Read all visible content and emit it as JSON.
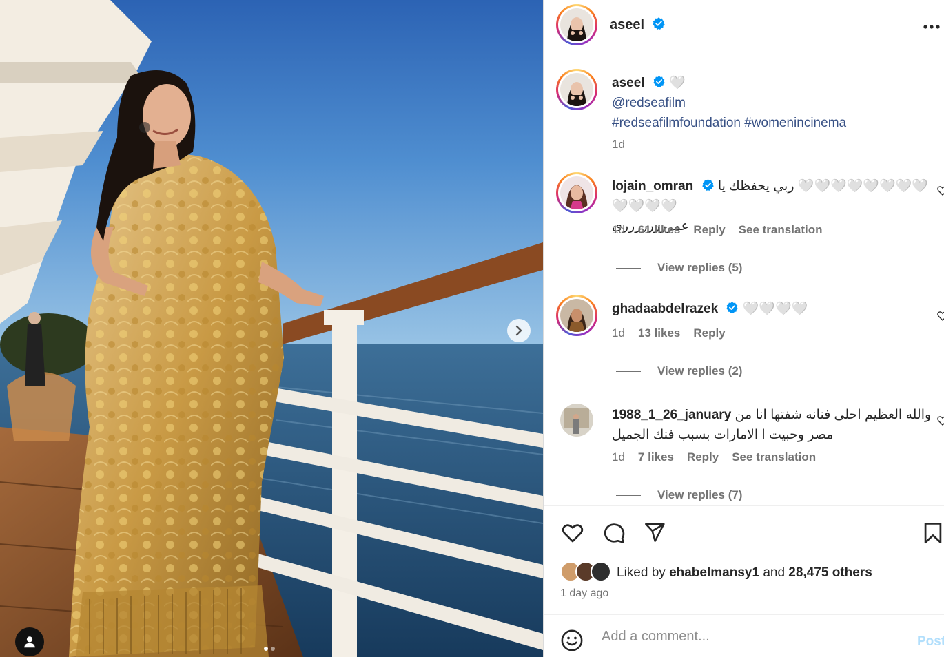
{
  "media": {
    "dots_total": 2,
    "dots_active": 0,
    "next_icon": "chevron-right-icon",
    "tag_icon": "user-tag-icon"
  },
  "post": {
    "author": "aseel",
    "caption_emoji": "🤍",
    "caption_mention": "@redseafilm",
    "caption_hashtags": "#redseafilmfoundation #womenincinema",
    "caption_time": "1d"
  },
  "comments": [
    {
      "user": "lojain_omran",
      "verified": true,
      "text_line1": "ربي يحفظك يا 🤍🤍🤍🤍🤍🤍🤍🤍🤍🤍🤍🤍",
      "text_line2": "عمرررررررري",
      "time": "1d",
      "likes": "61 likes",
      "reply": "Reply",
      "translation": "See translation",
      "view_replies": "View replies (5)"
    },
    {
      "user": "ghadaabdelrazek",
      "verified": true,
      "text_line1": "🤍🤍🤍🤍",
      "time": "1d",
      "likes": "13 likes",
      "reply": "Reply",
      "view_replies": "View replies (2)"
    },
    {
      "user": "1988_1_26_january",
      "verified": false,
      "text_line1": "والله العظيم احلى فنانه شفتها انا من",
      "text_line2": "مصر وحبيت ا الامارات بسبب فنك الجميل",
      "time": "1d",
      "likes": "7 likes",
      "reply": "Reply",
      "translation": "See translation",
      "view_replies": "View replies (7)"
    }
  ],
  "actions": {
    "liked_by_prefix": "Liked by",
    "liked_by_user": "ehabelmansy1",
    "liked_by_and": "and",
    "liked_by_others": "28,475 others",
    "time_ago": "1 day ago"
  },
  "comment_box": {
    "placeholder": "Add a comment...",
    "post_label": "Post",
    "emoji_icon": "emoji-icon"
  },
  "colors": {
    "verified": "#0095f6",
    "link": "#385185",
    "muted": "#737373",
    "post_disabled": "#b2dffc"
  }
}
